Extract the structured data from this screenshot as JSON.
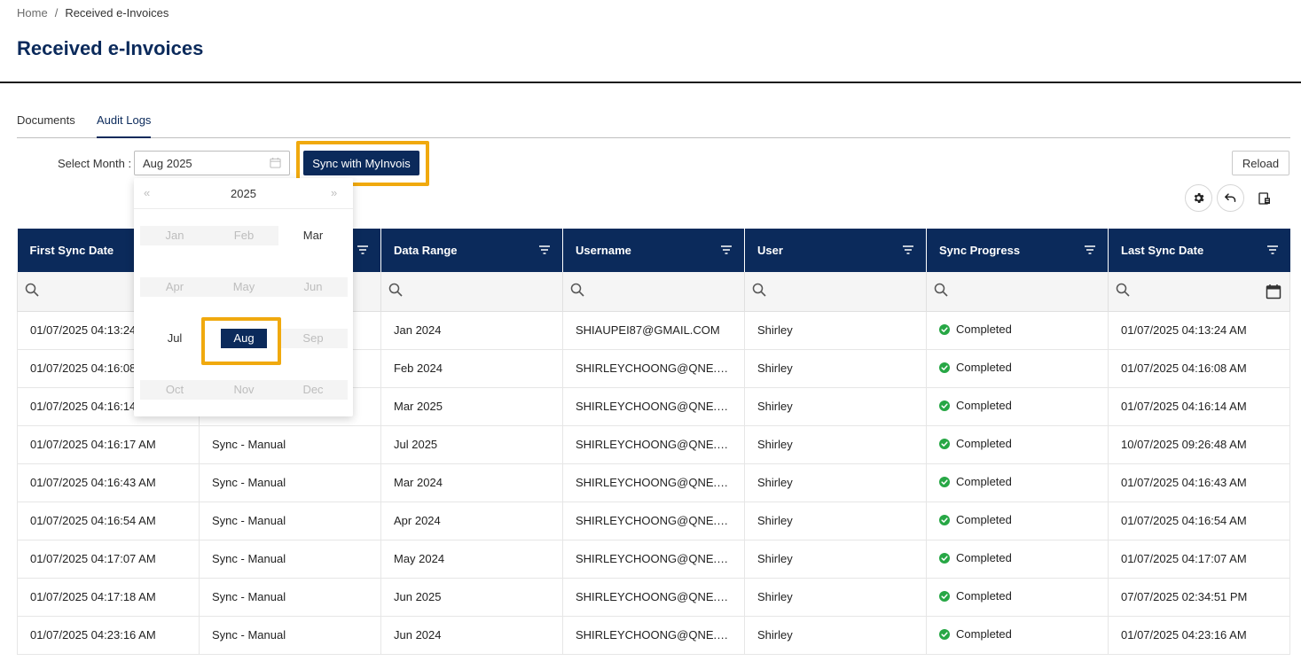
{
  "breadcrumb": {
    "home": "Home",
    "separator": "/",
    "current": "Received e-Invoices"
  },
  "page_title": "Received e-Invoices",
  "tabs": [
    {
      "label": "Documents",
      "active": false
    },
    {
      "label": "Audit Logs",
      "active": true
    }
  ],
  "toolbar": {
    "select_month_label": "Select Month :",
    "month_value": "Aug 2025",
    "sync_label": "Sync with MyInvois",
    "reload_label": "Reload"
  },
  "icons": {
    "settings": "gear-icon",
    "undo": "undo-icon",
    "export": "export-icon",
    "search": "search-icon",
    "calendar": "calendar-icon",
    "filter": "filter-icon",
    "check": "check-circle-icon"
  },
  "colors": {
    "primary": "#0b2a5b",
    "highlight": "#f0a90e",
    "success": "#27a745"
  },
  "picker": {
    "year": "2025",
    "prev": "«",
    "next": "»",
    "months": [
      {
        "label": "Jan",
        "state": "disabled"
      },
      {
        "label": "Feb",
        "state": "disabled"
      },
      {
        "label": "Mar",
        "state": "enabled"
      },
      {
        "label": "Apr",
        "state": "disabled"
      },
      {
        "label": "May",
        "state": "disabled"
      },
      {
        "label": "Jun",
        "state": "disabled"
      },
      {
        "label": "Jul",
        "state": "enabled"
      },
      {
        "label": "Aug",
        "state": "selected"
      },
      {
        "label": "Sep",
        "state": "disabled"
      },
      {
        "label": "Oct",
        "state": "disabled"
      },
      {
        "label": "Nov",
        "state": "disabled"
      },
      {
        "label": "Dec",
        "state": "disabled"
      }
    ]
  },
  "table": {
    "columns": [
      "First Sync Date",
      "",
      "Data Range",
      "Username",
      "User",
      "Sync Progress",
      "Last Sync Date"
    ],
    "rows": [
      [
        "01/07/2025 04:13:24",
        "",
        "Jan 2024",
        "SHIAUPEI87@GMAIL.COM",
        "Shirley",
        "Completed",
        "01/07/2025 04:13:24 AM"
      ],
      [
        "01/07/2025 04:16:08",
        "",
        "Feb 2024",
        "SHIRLEYCHOONG@QNE.COM...",
        "Shirley",
        "Completed",
        "01/07/2025 04:16:08 AM"
      ],
      [
        "01/07/2025 04:16:14",
        "",
        "Mar 2025",
        "SHIRLEYCHOONG@QNE.COM...",
        "Shirley",
        "Completed",
        "01/07/2025 04:16:14 AM"
      ],
      [
        "01/07/2025 04:16:17 AM",
        "Sync - Manual",
        "Jul 2025",
        "SHIRLEYCHOONG@QNE.COM...",
        "Shirley",
        "Completed",
        "10/07/2025 09:26:48 AM"
      ],
      [
        "01/07/2025 04:16:43 AM",
        "Sync - Manual",
        "Mar 2024",
        "SHIRLEYCHOONG@QNE.COM...",
        "Shirley",
        "Completed",
        "01/07/2025 04:16:43 AM"
      ],
      [
        "01/07/2025 04:16:54 AM",
        "Sync - Manual",
        "Apr 2024",
        "SHIRLEYCHOONG@QNE.COM...",
        "Shirley",
        "Completed",
        "01/07/2025 04:16:54 AM"
      ],
      [
        "01/07/2025 04:17:07 AM",
        "Sync - Manual",
        "May 2024",
        "SHIRLEYCHOONG@QNE.COM...",
        "Shirley",
        "Completed",
        "01/07/2025 04:17:07 AM"
      ],
      [
        "01/07/2025 04:17:18 AM",
        "Sync - Manual",
        "Jun 2025",
        "SHIRLEYCHOONG@QNE.COM...",
        "Shirley",
        "Completed",
        "07/07/2025 02:34:51 PM"
      ],
      [
        "01/07/2025 04:23:16 AM",
        "Sync - Manual",
        "Jun 2024",
        "SHIRLEYCHOONG@QNE.COM...",
        "Shirley",
        "Completed",
        "01/07/2025 04:23:16 AM"
      ]
    ]
  }
}
